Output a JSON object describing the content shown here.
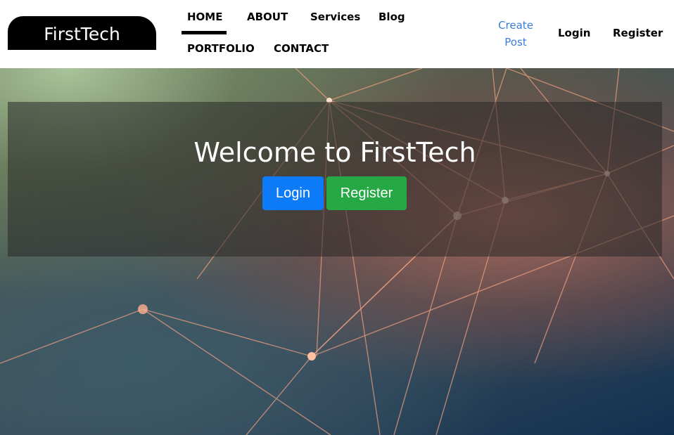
{
  "header": {
    "logo": "FirstTech",
    "nav": [
      {
        "label": "HOME",
        "active": true
      },
      {
        "label": "ABOUT"
      },
      {
        "label": "Services"
      },
      {
        "label": "Blog"
      },
      {
        "label": "PORTFOLIO"
      },
      {
        "label": "CONTACT"
      }
    ],
    "create_post": "Create Post",
    "login": "Login",
    "register": "Register"
  },
  "hero": {
    "title": "Welcome to FirstTech",
    "login_label": "Login",
    "register_label": "Register"
  },
  "colors": {
    "login": "#0d7bf7",
    "register": "#26a845",
    "link": "#3b7dd8"
  }
}
